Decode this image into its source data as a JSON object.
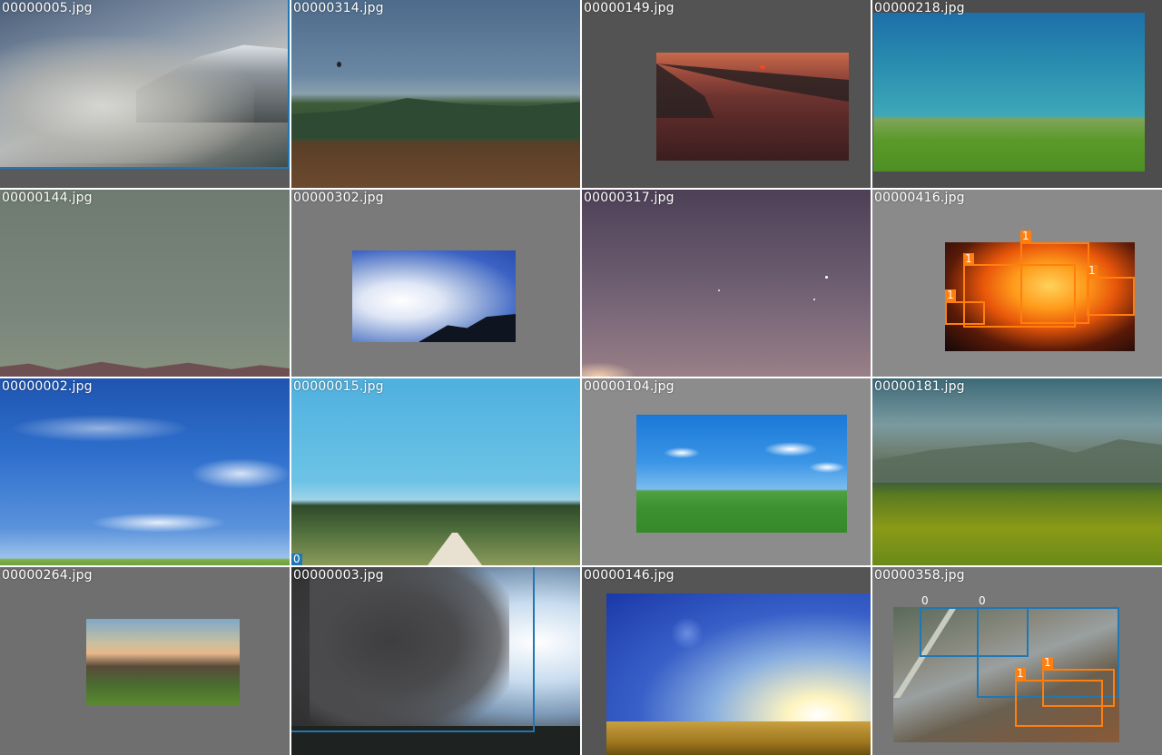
{
  "colors": {
    "class0": "#1f77b4",
    "class1": "#ff7f0e"
  },
  "tiles": [
    {
      "filename": "00000005.jpg",
      "boxes": [
        {
          "label": ""
        }
      ]
    },
    {
      "filename": "00000314.jpg",
      "boxes": []
    },
    {
      "filename": "00000149.jpg",
      "boxes": []
    },
    {
      "filename": "00000218.jpg",
      "boxes": []
    },
    {
      "filename": "00000144.jpg",
      "boxes": []
    },
    {
      "filename": "00000302.jpg",
      "boxes": []
    },
    {
      "filename": "00000317.jpg",
      "boxes": []
    },
    {
      "filename": "00000416.jpg",
      "boxes": [
        {
          "label": "1"
        },
        {
          "label": "1"
        },
        {
          "label": "1"
        },
        {
          "label": "1"
        }
      ]
    },
    {
      "filename": "00000002.jpg",
      "boxes": []
    },
    {
      "filename": "00000015.jpg",
      "boxes": [
        {
          "label": "0"
        }
      ]
    },
    {
      "filename": "00000104.jpg",
      "boxes": []
    },
    {
      "filename": "00000181.jpg",
      "boxes": []
    },
    {
      "filename": "00000264.jpg",
      "boxes": []
    },
    {
      "filename": "00000003.jpg",
      "boxes": [
        {
          "label": ""
        }
      ]
    },
    {
      "filename": "00000146.jpg",
      "boxes": []
    },
    {
      "filename": "00000358.jpg",
      "boxes": [
        {
          "label": "0"
        },
        {
          "label": "0"
        },
        {
          "label": "1"
        },
        {
          "label": "1"
        }
      ]
    }
  ]
}
